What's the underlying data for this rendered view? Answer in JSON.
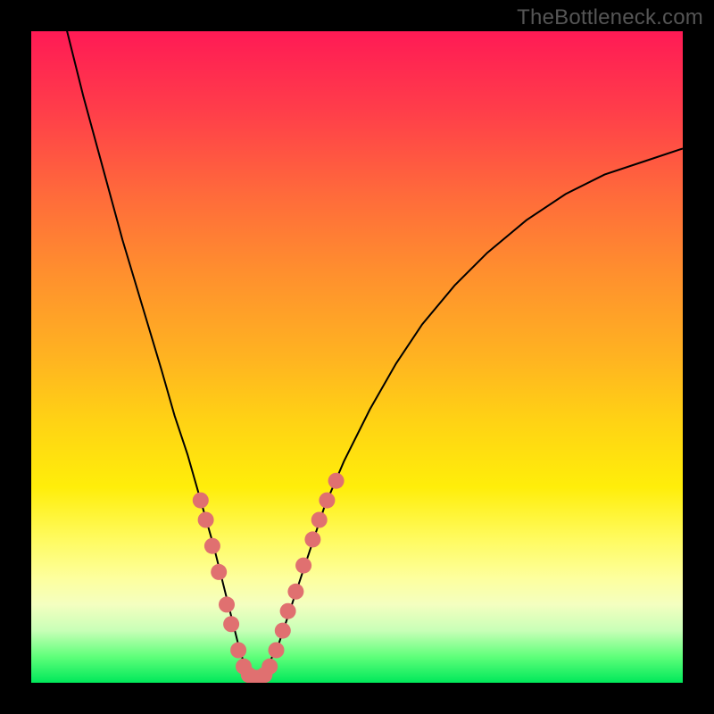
{
  "attribution": "TheBottleneck.com",
  "colors": {
    "background": "#000000",
    "gradient_top": "#ff1a55",
    "gradient_bottom": "#00e85a",
    "curve_stroke": "#000000",
    "marker_fill": "#e07070"
  },
  "chart_data": {
    "type": "line",
    "title": "",
    "xlabel": "",
    "ylabel": "",
    "xlim": [
      0,
      100
    ],
    "ylim": [
      0,
      100
    ],
    "grid": false,
    "legend": false,
    "series": [
      {
        "name": "bottleneck-curve",
        "x": [
          5,
          8,
          11,
          14,
          17,
          20,
          22,
          24,
          26,
          28,
          30,
          31,
          32,
          33,
          34,
          35,
          36,
          38,
          40,
          42,
          45,
          48,
          52,
          56,
          60,
          65,
          70,
          76,
          82,
          88,
          94,
          100
        ],
        "y": [
          102,
          90,
          79,
          68,
          58,
          48,
          41,
          35,
          28,
          21,
          13,
          9,
          5,
          2,
          1,
          1,
          2,
          6,
          12,
          18,
          27,
          34,
          42,
          49,
          55,
          61,
          66,
          71,
          75,
          78,
          80,
          82
        ]
      }
    ],
    "markers": {
      "name": "highlight-points",
      "points": [
        {
          "x": 26.0,
          "y": 28
        },
        {
          "x": 26.8,
          "y": 25
        },
        {
          "x": 27.8,
          "y": 21
        },
        {
          "x": 28.8,
          "y": 17
        },
        {
          "x": 30.0,
          "y": 12
        },
        {
          "x": 30.7,
          "y": 9
        },
        {
          "x": 31.8,
          "y": 5
        },
        {
          "x": 32.6,
          "y": 2.5
        },
        {
          "x": 33.4,
          "y": 1.2
        },
        {
          "x": 34.2,
          "y": 0.8
        },
        {
          "x": 35.0,
          "y": 0.8
        },
        {
          "x": 35.8,
          "y": 1.2
        },
        {
          "x": 36.6,
          "y": 2.5
        },
        {
          "x": 37.6,
          "y": 5
        },
        {
          "x": 38.6,
          "y": 8
        },
        {
          "x": 39.4,
          "y": 11
        },
        {
          "x": 40.6,
          "y": 14
        },
        {
          "x": 41.8,
          "y": 18
        },
        {
          "x": 43.2,
          "y": 22
        },
        {
          "x": 44.2,
          "y": 25
        },
        {
          "x": 45.4,
          "y": 28
        },
        {
          "x": 46.8,
          "y": 31
        }
      ],
      "radius_px": 9
    }
  }
}
